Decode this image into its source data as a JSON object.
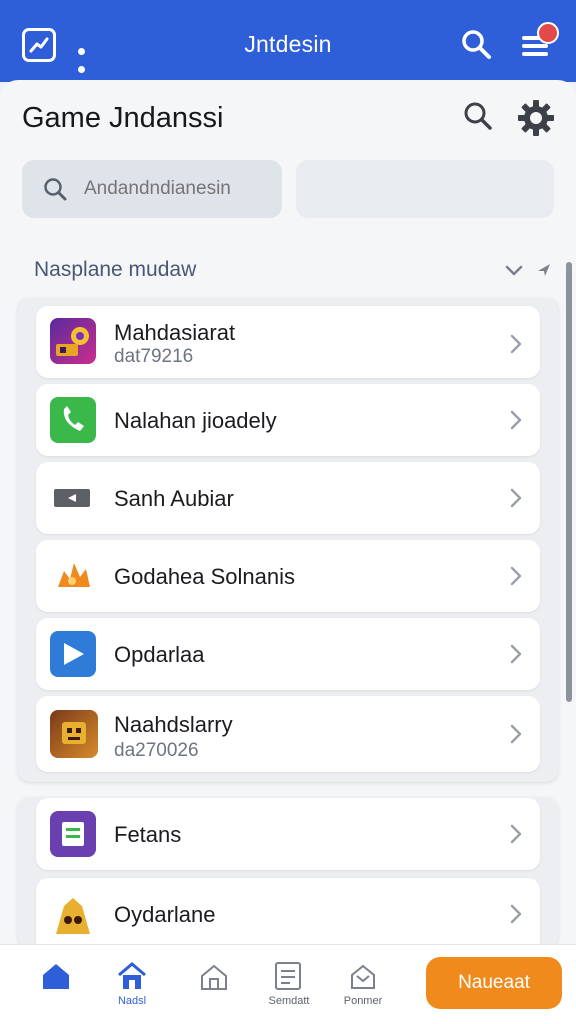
{
  "app_bar": {
    "title": "Jntdesin",
    "accent": "#2f5fd8",
    "badge_color": "#e24a4a",
    "icons": [
      "trend-chart-icon",
      "more-dots-icon",
      "search-icon",
      "hamburger-menu-icon"
    ]
  },
  "header": {
    "title": "Game Jndanssi",
    "icons": [
      "search-icon",
      "gear-icon"
    ]
  },
  "search": {
    "placeholder": "Andandndianesin",
    "value": ""
  },
  "section": {
    "label": "Nasplane mudaw"
  },
  "list_primary": [
    {
      "label": "Mahdasiarat",
      "sub": "dat79216",
      "icon": "game-thumbnail-purple"
    },
    {
      "label": "Nalahan jioadely",
      "sub": "",
      "icon": "phone-icon"
    },
    {
      "label": "Sanh Aubiar",
      "sub": "",
      "icon": "card-icon"
    },
    {
      "label": "Godahea Solnanis",
      "sub": "",
      "icon": "flame-icon"
    },
    {
      "label": "Opdarlaa",
      "sub": "",
      "icon": "play-icon"
    },
    {
      "label": "Naahdslarry",
      "sub": "da270026",
      "icon": "game-thumbnail-robot"
    }
  ],
  "list_secondary": [
    {
      "label": "Fetans",
      "sub": "",
      "icon": "list-card-icon"
    },
    {
      "label": "Oydarlane",
      "sub": "",
      "icon": "monster-icon"
    }
  ],
  "bottom_nav": {
    "tabs": [
      {
        "label": "",
        "icon": "home-icon"
      },
      {
        "label": "Nadsl",
        "icon": "home-outline-icon"
      },
      {
        "label": "",
        "icon": "house-icon"
      },
      {
        "label": "Semdatt",
        "icon": "document-icon"
      },
      {
        "label": "Ponmer",
        "icon": "inbox-icon"
      }
    ],
    "cta_label": "Naueaat",
    "cta_color": "#f08a1c"
  }
}
